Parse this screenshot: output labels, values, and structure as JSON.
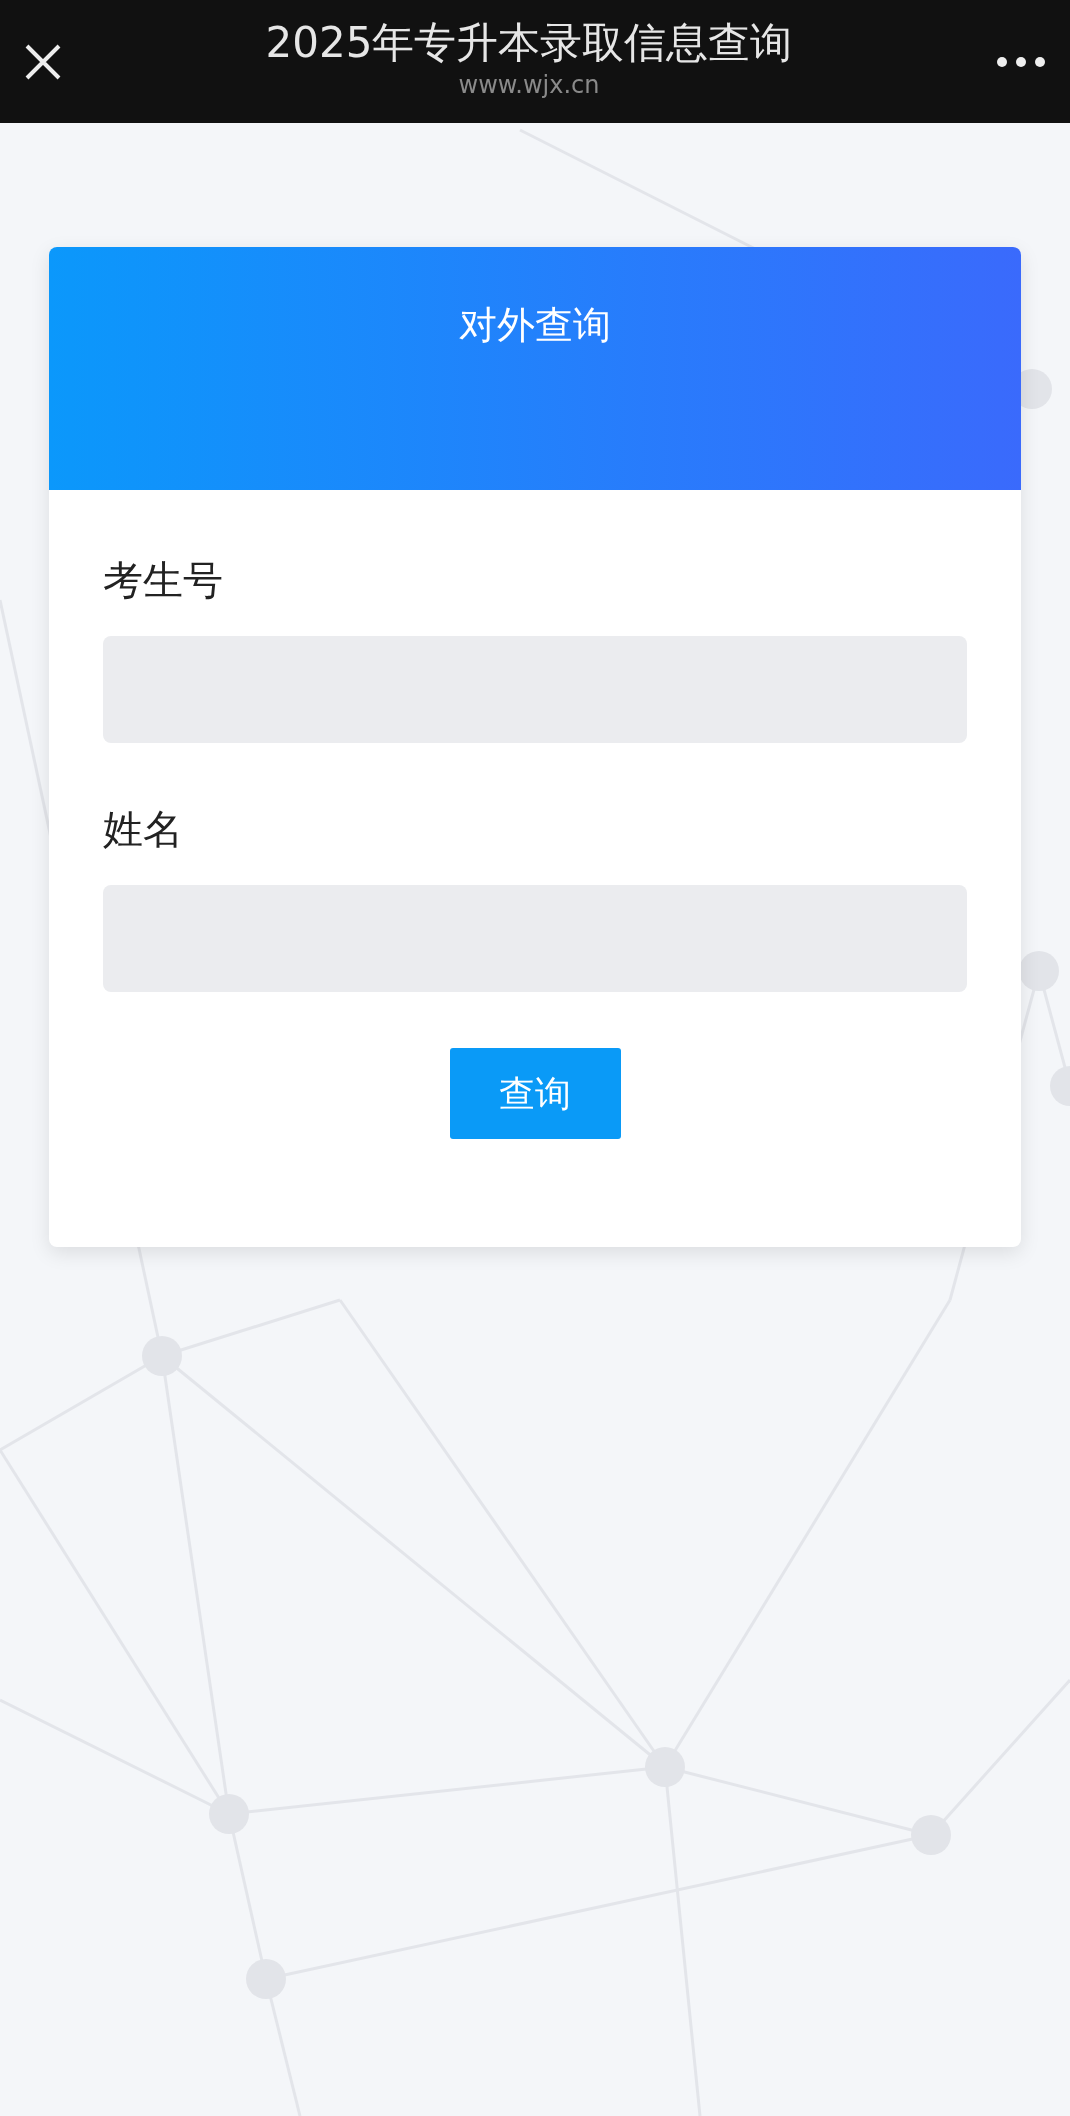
{
  "top_bar": {
    "title": "2025年专升本录取信息查询",
    "subtitle": "www.wjx.cn"
  },
  "card": {
    "title": "对外查询"
  },
  "fields": [
    {
      "label": "考生号"
    },
    {
      "label": "姓名"
    }
  ],
  "button": "查询"
}
